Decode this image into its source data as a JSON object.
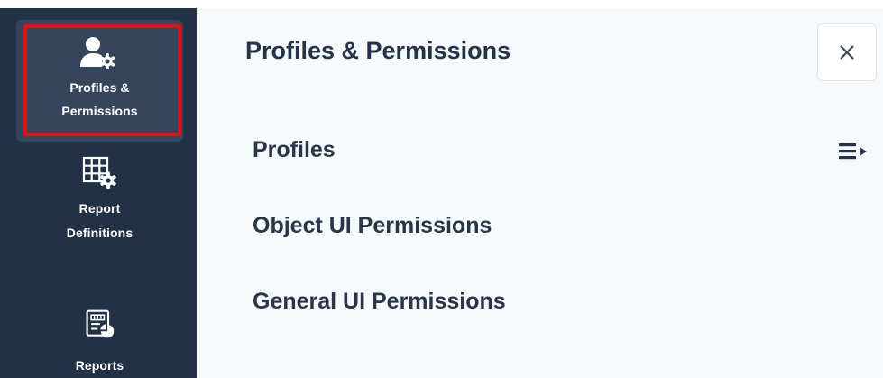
{
  "sidebar": {
    "items": [
      {
        "line1": "Profiles &",
        "line2": "Permissions",
        "icon": "user-gear-icon",
        "active": true
      },
      {
        "line1": "Report",
        "line2": "Definitions",
        "icon": "grid-gear-icon",
        "active": false
      },
      {
        "line1": "Reports",
        "icon": "report-chart-icon",
        "active": false
      }
    ]
  },
  "panel": {
    "title": "Profiles & Permissions",
    "close_icon": "close-icon",
    "links": [
      {
        "label": "Profiles"
      },
      {
        "label": "Object UI Permissions"
      },
      {
        "label": "General UI Permissions"
      }
    ],
    "expand_icon": "expand-list-icon"
  },
  "colors": {
    "sidebar_bg": "#223146",
    "sidebar_active": "#35465c",
    "highlight_border": "#e40f14",
    "panel_bg": "#f6f9fc",
    "text_dark": "#24324a"
  }
}
